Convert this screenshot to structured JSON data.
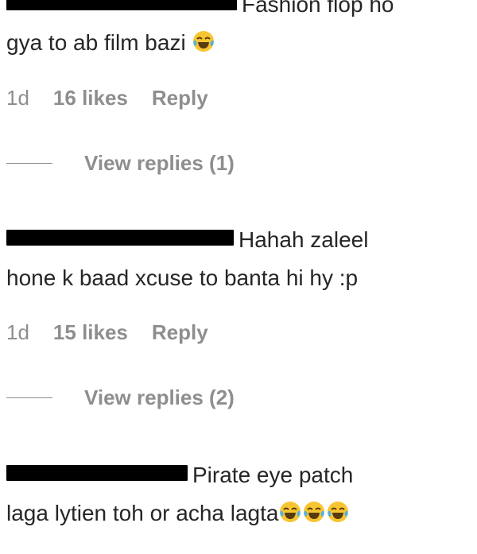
{
  "comments": [
    {
      "redacted_username": true,
      "text_line1": "Fashion flop ho",
      "text_line2": "gya to ab film bazi",
      "emojis": [
        "laughing-tears"
      ],
      "time": "1d",
      "likes": "16 likes",
      "reply_label": "Reply",
      "view_replies": "View replies (1)"
    },
    {
      "redacted_username": true,
      "text_line1": "Hahah zaleel",
      "text_line2": "hone k baad xcuse to banta hi hy :p",
      "time": "1d",
      "likes": "15 likes",
      "reply_label": "Reply",
      "view_replies": "View replies (2)"
    },
    {
      "redacted_username": true,
      "text_line1": "Pirate eye patch",
      "text_line2": "laga lytien toh or acha lagta",
      "emojis": [
        "laughing-tears",
        "laughing-tears",
        "laughing-tears"
      ]
    }
  ]
}
